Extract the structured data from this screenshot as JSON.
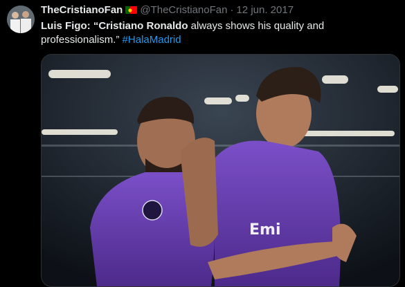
{
  "tweet": {
    "author_name": "TheCristianoFan",
    "author_flag": "portugal-flag-icon",
    "author_handle": "@TheCristianoFan",
    "separator": "·",
    "date": "12 jun. 2017",
    "text_bold_1": "Luis Figo:",
    "text_bold_2": "“Cristiano Ronaldo",
    "text_rest": " always shows his quality and professionalism.”",
    "hashtag": "#HalaMadrid"
  },
  "media": {
    "jersey_text": "Emi",
    "kit_color": "#6b3fb3"
  },
  "colors": {
    "background": "#000000",
    "text": "#e7e9ea",
    "muted": "#71767b",
    "link": "#1d9bf0"
  }
}
